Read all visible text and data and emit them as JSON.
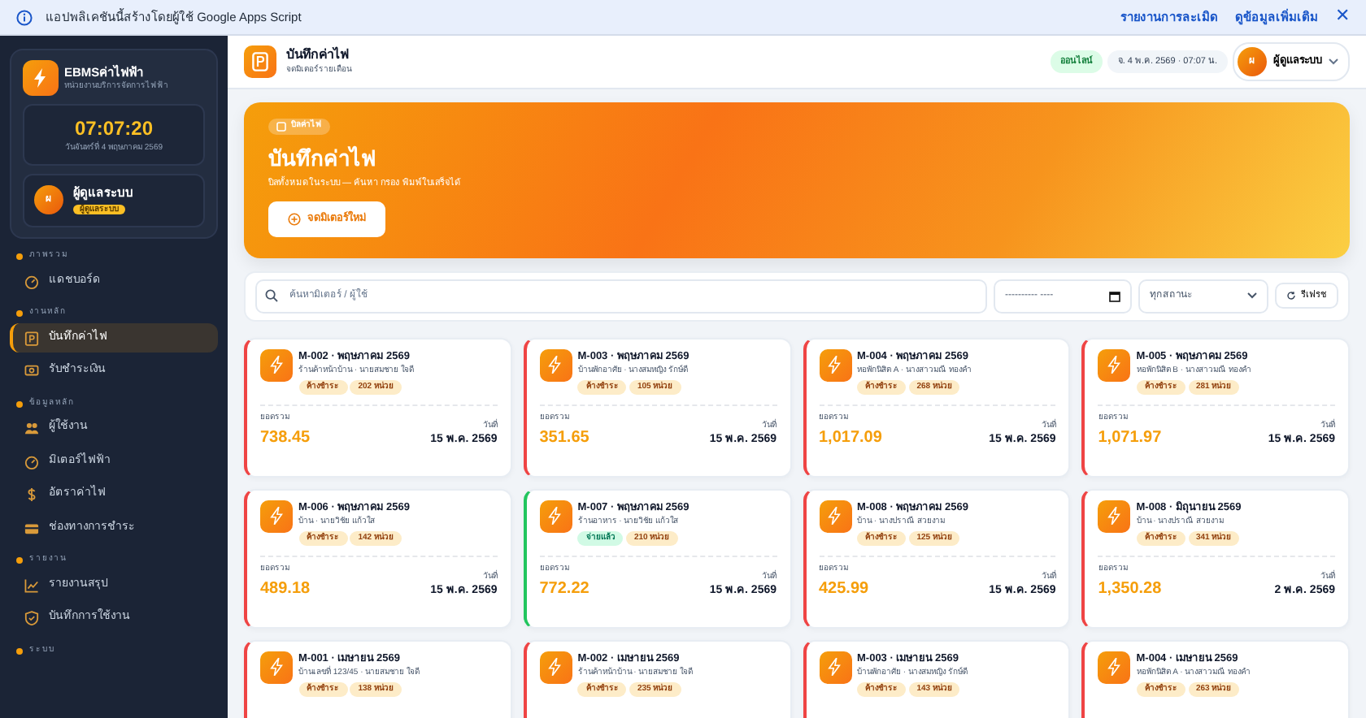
{
  "banner": {
    "text": "แอปพลิเคชันนี้สร้างโดยผู้ใช้ Google Apps Script",
    "links": [
      "รายงานการละเมิด",
      "ดูข้อมูลเพิ่มเติม"
    ],
    "close": "✕"
  },
  "sidebar": {
    "brand": {
      "title": "EBMSค่าไฟฟ้า",
      "subtitle": "หน่วยงานบริการจัดการไฟฟ้า"
    },
    "clock": {
      "time": "07:07:20",
      "date": "วันจันทร์ที่ 4 พฤษภาคม 2569"
    },
    "user": {
      "avatar": "ผ",
      "name": "ผู้ดูแลระบบ",
      "role": "ผู้ดูแลระบบ"
    },
    "sections": [
      {
        "title": "ภาพรวม",
        "items": [
          {
            "label": "แดชบอร์ด",
            "selected": false
          }
        ]
      },
      {
        "title": "งานหลัก",
        "items": [
          {
            "label": "บันทึกค่าไฟ",
            "selected": true
          },
          {
            "label": "รับชำระเงิน",
            "selected": false
          }
        ]
      },
      {
        "title": "ข้อมูลหลัก",
        "items": [
          {
            "label": "ผู้ใช้งาน",
            "selected": false
          },
          {
            "label": "มิเตอร์ไฟฟ้า",
            "selected": false
          },
          {
            "label": "อัตราค่าไฟ",
            "selected": false
          },
          {
            "label": "ช่องทางการชำระ",
            "selected": false
          }
        ]
      },
      {
        "title": "รายงาน",
        "items": [
          {
            "label": "รายงานสรุป",
            "selected": false
          },
          {
            "label": "บันทึกการใช้งาน",
            "selected": false
          }
        ]
      },
      {
        "title": "ระบบ"
      }
    ]
  },
  "header": {
    "title": "บันทึกค่าไฟ",
    "subtitle": "จดมิเตอร์รายเดือน",
    "status": "ออนไลน์",
    "datetime": "จ. 4 พ.ค. 2569 · 07:07 น.",
    "user": {
      "avatar": "ผ",
      "name": "ผู้ดูแลระบบ"
    }
  },
  "hero": {
    "tag": "บิลค่าไฟ",
    "title": "บันทึกค่าไฟ",
    "subtitle": "บิลทั้งหมดในระบบ — ค้นหา กรอง พิมพ์ใบเสร็จได้",
    "button": "จดมิเตอร์ใหม่"
  },
  "filters": {
    "search_placeholder": "ค้นหามิเตอร์ / ผู้ใช้",
    "date": "---------- ----",
    "status_select": "ทุกสถานะ",
    "refresh": "รีเฟรช"
  },
  "bills": [
    {
      "title": "M-002 · พฤษภาคม 2569",
      "subtitle": "ร้านค้าหน้าบ้าน · นายสมชาย ใจดี",
      "status": "ค้างชำระ",
      "paid": false,
      "units": "202 หน่วย",
      "total_label": "ยอดรวม",
      "total": "738.45",
      "date_label": "วันที่",
      "date": "15 พ.ค. 2569"
    },
    {
      "title": "M-003 · พฤษภาคม 2569",
      "subtitle": "บ้านพักอาศัย · นางสมหญิง รักษ์ดี",
      "status": "ค้างชำระ",
      "paid": false,
      "units": "105 หน่วย",
      "total_label": "ยอดรวม",
      "total": "351.65",
      "date_label": "วันที่",
      "date": "15 พ.ค. 2569"
    },
    {
      "title": "M-004 · พฤษภาคม 2569",
      "subtitle": "หอพักนิสิต A · นางสาวมณี ทองคำ",
      "status": "ค้างชำระ",
      "paid": false,
      "units": "268 หน่วย",
      "total_label": "ยอดรวม",
      "total": "1,017.09",
      "date_label": "วันที่",
      "date": "15 พ.ค. 2569"
    },
    {
      "title": "M-005 · พฤษภาคม 2569",
      "subtitle": "หอพักนิสิต B · นางสาวมณี ทองคำ",
      "status": "ค้างชำระ",
      "paid": false,
      "units": "281 หน่วย",
      "total_label": "ยอดรวม",
      "total": "1,071.97",
      "date_label": "วันที่",
      "date": "15 พ.ค. 2569"
    },
    {
      "title": "M-006 · พฤษภาคม 2569",
      "subtitle": "บ้าน · นายวิชัย แก้วใส",
      "status": "ค้างชำระ",
      "paid": false,
      "units": "142 หน่วย",
      "total_label": "ยอดรวม",
      "total": "489.18",
      "date_label": "วันที่",
      "date": "15 พ.ค. 2569"
    },
    {
      "title": "M-007 · พฤษภาคม 2569",
      "subtitle": "ร้านอาหาร · นายวิชัย แก้วใส",
      "status": "จ่ายแล้ว",
      "paid": true,
      "units": "210 หน่วย",
      "total_label": "ยอดรวม",
      "total": "772.22",
      "date_label": "วันที่",
      "date": "15 พ.ค. 2569"
    },
    {
      "title": "M-008 · พฤษภาคม 2569",
      "subtitle": "บ้าน · นางปราณี สวยงาม",
      "status": "ค้างชำระ",
      "paid": false,
      "units": "125 หน่วย",
      "total_label": "ยอดรวม",
      "total": "425.99",
      "date_label": "วันที่",
      "date": "15 พ.ค. 2569"
    },
    {
      "title": "M-008 · มิถุนายน 2569",
      "subtitle": "บ้าน · นางปราณี สวยงาม",
      "status": "ค้างชำระ",
      "paid": false,
      "units": "341 หน่วย",
      "total_label": "ยอดรวม",
      "total": "1,350.28",
      "date_label": "วันที่",
      "date": "2 พ.ค. 2569"
    },
    {
      "title": "M-001 · เมษายน 2569",
      "subtitle": "บ้านเลขที่ 123/45 · นายสมชาย ใจดี",
      "status": "ค้างชำระ",
      "paid": false,
      "units": "138 หน่วย"
    },
    {
      "title": "M-002 · เมษายน 2569",
      "subtitle": "ร้านค้าหน้าบ้าน · นายสมชาย ใจดี",
      "status": "ค้างชำระ",
      "paid": false,
      "units": "235 หน่วย"
    },
    {
      "title": "M-003 · เมษายน 2569",
      "subtitle": "บ้านพักอาศัย · นางสมหญิง รักษ์ดี",
      "status": "ค้างชำระ",
      "paid": false,
      "units": "143 หน่วย"
    },
    {
      "title": "M-004 · เมษายน 2569",
      "subtitle": "หอพักนิสิต A · นางสาวมณี ทองคำ",
      "status": "ค้างชำระ",
      "paid": false,
      "units": "263 หน่วย"
    }
  ]
}
